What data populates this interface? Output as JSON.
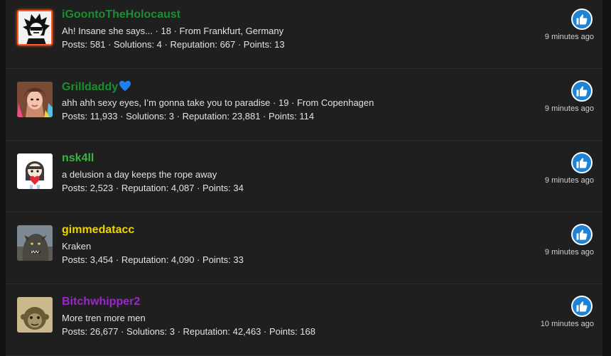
{
  "rows": [
    {
      "name": "iGoontoTheHolocaust",
      "name_color": "#1a8f2e",
      "bio": "Ah! Insane she says... · 18 · From Frankfurt, Germany",
      "stats": "Posts: 581 · Solutions: 4 · Reputation: 667 · Points: 13",
      "time": "9 minutes ago",
      "avatar": "dark-haired-character-avatar",
      "like_icon": "thumbs-up-icon"
    },
    {
      "name": "Grilldaddy",
      "name_color": "#1a8f2e",
      "name_suffix_icon": "blue-heart-icon",
      "bio": "ahh ahh sexy eyes, I’m gonna take you to paradise · 19 · From Copenhagen",
      "stats": "Posts: 11,933 · Solutions: 3 · Reputation: 23,881 · Points: 114",
      "time": "9 minutes ago",
      "avatar": "colorful-hair-avatar",
      "like_icon": "thumbs-up-icon"
    },
    {
      "name": "nsk4ll",
      "name_color": "#3ab53f",
      "bio": "a delusion a day keeps the rope away",
      "stats": "Posts: 2,523 · Reputation: 4,087 · Points: 34",
      "time": "9 minutes ago",
      "avatar": "anime-girl-heart-avatar",
      "like_icon": "thumbs-up-icon"
    },
    {
      "name": "gimmedatacc",
      "name_color": "#f0d400",
      "bio": "Kraken",
      "stats": "Posts: 3,454 · Reputation: 4,090 · Points: 33",
      "time": "9 minutes ago",
      "avatar": "kraken-creature-avatar",
      "like_icon": "thumbs-up-icon"
    },
    {
      "name": "Bitchwhipper2",
      "name_color": "#9b27c9",
      "bio": "More tren more men",
      "stats": "Posts: 26,677 · Solutions: 3 · Reputation: 42,463 · Points: 168",
      "time": "10 minutes ago",
      "avatar": "sepia-monkey-avatar",
      "like_icon": "thumbs-up-icon"
    }
  ]
}
